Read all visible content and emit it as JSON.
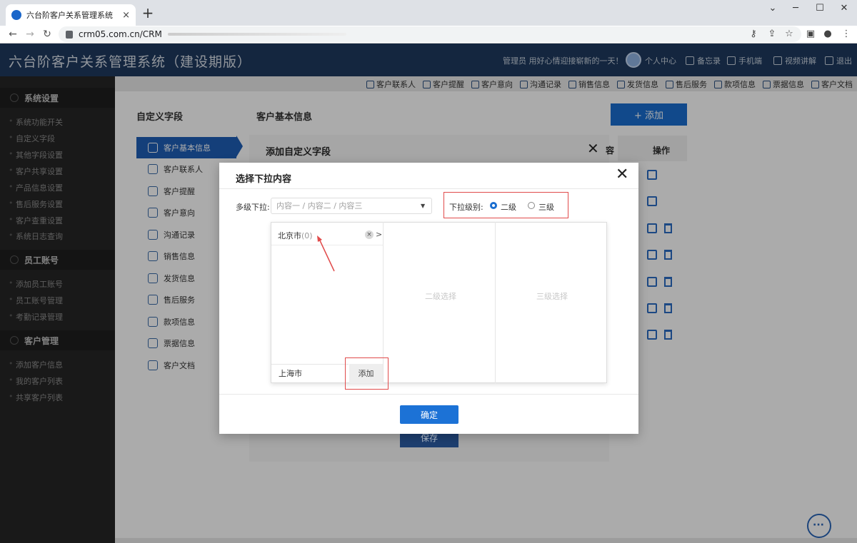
{
  "browser": {
    "tab_title": "六台阶客户关系管理系统（建设期",
    "tab_close": "×",
    "new_tab": "+",
    "url": "crm05.com.cn/CRM",
    "win_min": "─",
    "win_max": "☐",
    "win_close": "✕"
  },
  "app": {
    "title": "六台阶客户关系管理系统（建设期版）",
    "greeting": "管理员 用好心情迎接崭新的一天！",
    "header_links": [
      "个人中心",
      "备忘录",
      "手机端",
      "视频讲解",
      "退出"
    ]
  },
  "sidebar": {
    "groups": [
      {
        "title": "系统设置",
        "items": [
          "系统功能开关",
          "自定义字段",
          "其他字段设置",
          "客户共享设置",
          "产品信息设置",
          "售后服务设置",
          "客户查重设置",
          "系统日志查询"
        ]
      },
      {
        "title": "员工账号",
        "items": [
          "添加员工账号",
          "员工账号管理",
          "考勤记录管理"
        ]
      },
      {
        "title": "客户管理",
        "items": [
          "添加客户信息",
          "我的客户列表",
          "共享客户列表"
        ]
      }
    ]
  },
  "topnav": [
    "客户联系人",
    "客户提醒",
    "客户意向",
    "沟通记录",
    "销售信息",
    "发货信息",
    "售后服务",
    "款项信息",
    "票据信息",
    "客户文档"
  ],
  "page": {
    "left_title": "自定义字段",
    "section_title": "客户基本信息",
    "add_button": "+ 添加",
    "op_header": "操作",
    "left_nav": [
      "客户基本信息",
      "客户联系人",
      "客户提醒",
      "客户意向",
      "沟通记录",
      "销售信息",
      "发货信息",
      "售后服务",
      "款项信息",
      "票据信息",
      "客户文档"
    ]
  },
  "behind_dialog": {
    "title": "添加自定义字段",
    "col_label": "容",
    "save": "保存",
    "close": "✕"
  },
  "dialog": {
    "title": "选择下拉内容",
    "close": "✕",
    "multi_label": "多级下拉:",
    "multi_placeholder": "内容一 / 内容二 / 内容三",
    "level_label": "下拉级别:",
    "level_options": [
      "二级",
      "三级"
    ],
    "level_selected": "二级",
    "level1_item": "北京市",
    "level1_count": "(0)",
    "level2_placeholder": "二级选择",
    "level3_placeholder": "三级选择",
    "input_value": "上海市",
    "add_label": "添加",
    "ok_label": "确定"
  },
  "colors": {
    "accent": "#1c72d6",
    "header": "#1e3a5f",
    "highlight": "#e14b4b"
  }
}
